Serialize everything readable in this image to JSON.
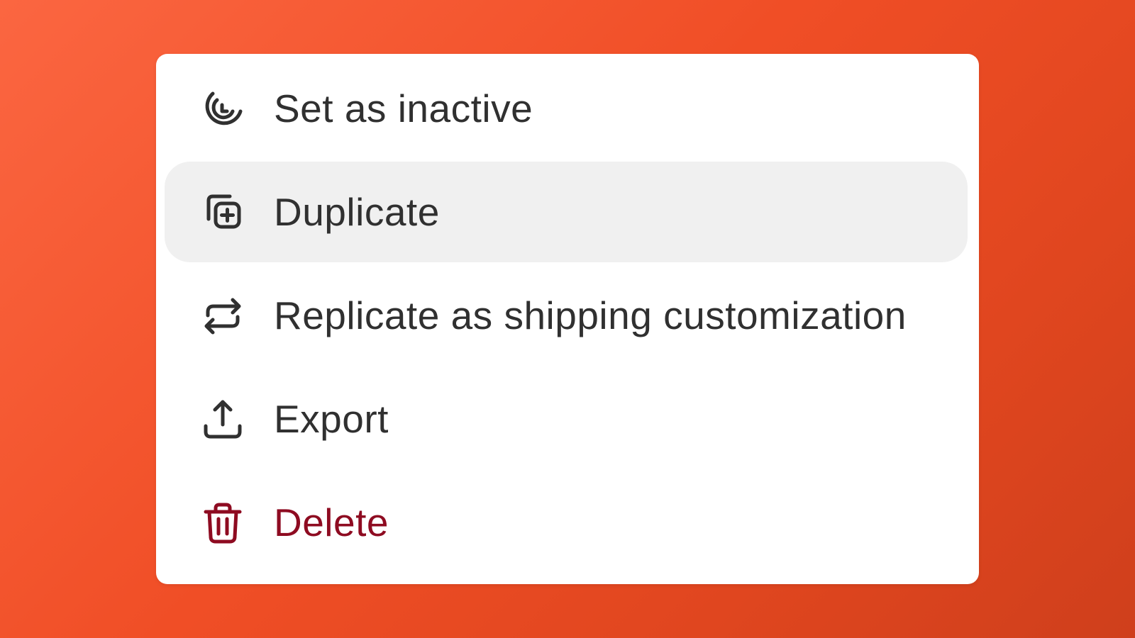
{
  "menu": {
    "items": [
      {
        "label": "Set as inactive",
        "icon": "inactive-icon",
        "state": "default"
      },
      {
        "label": "Duplicate",
        "icon": "duplicate-icon",
        "state": "hovered"
      },
      {
        "label": "Replicate as shipping customization",
        "icon": "replicate-icon",
        "state": "default"
      },
      {
        "label": "Export",
        "icon": "export-icon",
        "state": "default"
      },
      {
        "label": "Delete",
        "icon": "trash-icon",
        "state": "destructive"
      }
    ]
  },
  "colors": {
    "background_gradient_start": "#fb6641",
    "background_gradient_end": "#cf3f1c",
    "menu_background": "#ffffff",
    "hover_background": "#f0f0f0",
    "text": "#303030",
    "destructive_text": "#8e0b21"
  }
}
